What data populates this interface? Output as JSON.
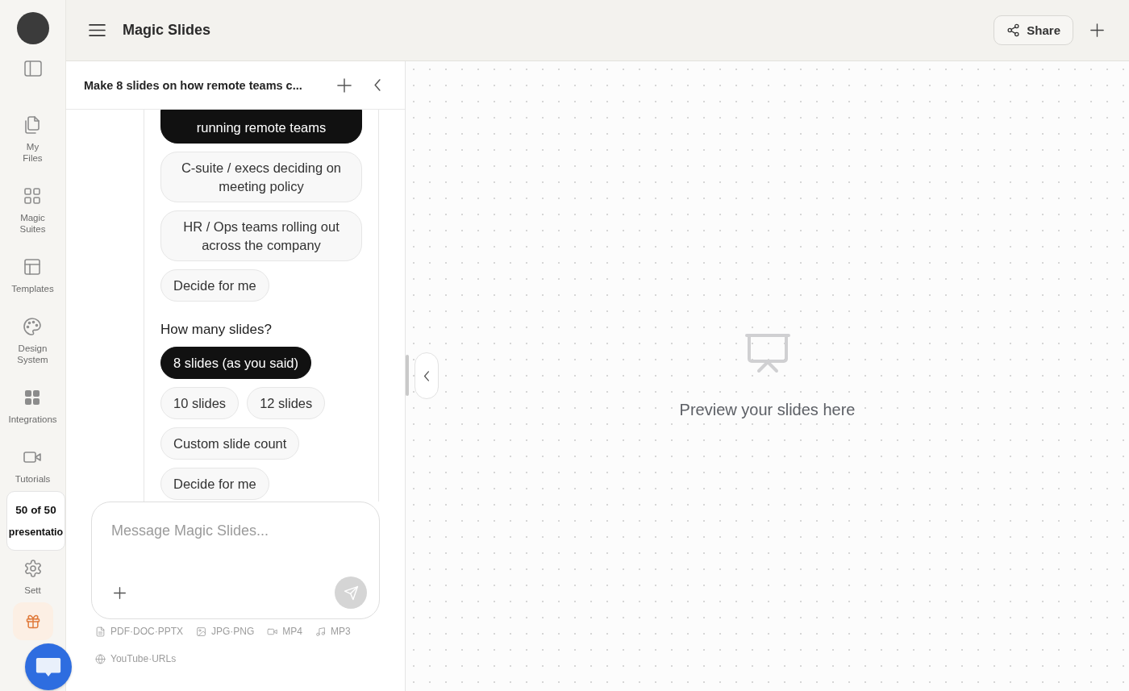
{
  "header": {
    "title": "Magic Slides",
    "share_label": "Share"
  },
  "sidebar": {
    "items": [
      {
        "label": "My Files"
      },
      {
        "label": "Magic Suites"
      },
      {
        "label": "Templates"
      },
      {
        "label": "Design System"
      },
      {
        "label": "Integrations"
      },
      {
        "label": "Tutorials"
      }
    ],
    "credits": {
      "count": "50 of 50",
      "unit": "presentatio"
    },
    "settings": {
      "label": "Sett"
    }
  },
  "chat": {
    "title": "Make 8 slides on how remote teams c...",
    "option_groups": [
      {
        "options": [
          {
            "label": "running remote teams",
            "selected": true
          },
          {
            "label": "C-suite / execs deciding on meeting policy",
            "selected": false
          },
          {
            "label": "HR / Ops teams rolling out across the company",
            "selected": false
          },
          {
            "label": "Decide for me",
            "selected": false
          }
        ]
      },
      {
        "question": "How many slides?",
        "options": [
          {
            "label": "8 slides (as you said)",
            "selected": true
          },
          {
            "label": "10 slides",
            "selected": false
          },
          {
            "label": "12 slides",
            "selected": false
          },
          {
            "label": "Custom slide count",
            "selected": false
          },
          {
            "label": "Decide for me",
            "selected": false
          }
        ]
      }
    ],
    "composer": {
      "placeholder": "Message Magic Slides...",
      "send_disabled": true,
      "formats": [
        {
          "label": "PDF·DOC·PPTX"
        },
        {
          "label": "JPG·PNG"
        },
        {
          "label": "MP4"
        },
        {
          "label": "MP3"
        },
        {
          "label": "YouTube·URLs"
        }
      ]
    }
  },
  "preview": {
    "message": "Preview your slides here"
  }
}
